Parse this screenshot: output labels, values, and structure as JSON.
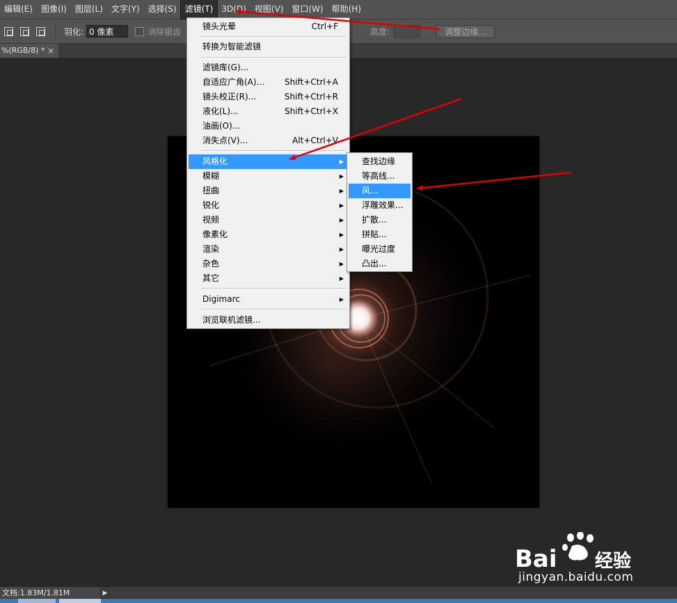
{
  "menubar": {
    "items": [
      {
        "label": "编辑(E)"
      },
      {
        "label": "图像(I)"
      },
      {
        "label": "图层(L)"
      },
      {
        "label": "文字(Y)"
      },
      {
        "label": "选择(S)"
      },
      {
        "label": "滤镜(T)"
      },
      {
        "label": "3D(D)"
      },
      {
        "label": "视图(V)"
      },
      {
        "label": "窗口(W)"
      },
      {
        "label": "帮助(H)"
      }
    ],
    "active_item": "滤镜(T)"
  },
  "options_bar": {
    "feather_label": "羽化:",
    "feather_value": "0 像素",
    "anti_alias_label": "消除锯齿",
    "height_label": "高度:",
    "refine_edge_button": "调整边缘..."
  },
  "document_tab": {
    "title": "%(RGB/8) *",
    "close_glyph": "×"
  },
  "filter_menu": {
    "last_filter": {
      "label": "镜头光晕",
      "shortcut": "Ctrl+F"
    },
    "convert_smart": "转换为智能滤镜",
    "items_group1": [
      {
        "label": "滤镜库(G)...",
        "shortcut": ""
      },
      {
        "label": "自适应广角(A)...",
        "shortcut": "Shift+Ctrl+A"
      },
      {
        "label": "镜头校正(R)...",
        "shortcut": "Shift+Ctrl+R"
      },
      {
        "label": "液化(L)...",
        "shortcut": "Shift+Ctrl+X"
      },
      {
        "label": "油画(O)...",
        "shortcut": ""
      },
      {
        "label": "消失点(V)...",
        "shortcut": "Alt+Ctrl+V"
      }
    ],
    "submenus": [
      {
        "label": "风格化"
      },
      {
        "label": "模糊"
      },
      {
        "label": "扭曲"
      },
      {
        "label": "锐化"
      },
      {
        "label": "视频"
      },
      {
        "label": "像素化"
      },
      {
        "label": "渲染"
      },
      {
        "label": "杂色"
      },
      {
        "label": "其它"
      }
    ],
    "highlighted": "风格化",
    "digimarc": "Digimarc",
    "browse_online": "浏览联机滤镜..."
  },
  "stylize_submenu": {
    "items": [
      {
        "label": "查找边缘"
      },
      {
        "label": "等高线..."
      },
      {
        "label": "风..."
      },
      {
        "label": "浮雕效果..."
      },
      {
        "label": "扩散..."
      },
      {
        "label": "拼贴..."
      },
      {
        "label": "曝光过度"
      },
      {
        "label": "凸出..."
      }
    ],
    "highlighted": "风..."
  },
  "status_bar": {
    "doc_info": "文档:1.83M/1.81M"
  },
  "watermark": {
    "brand_left": "Bai",
    "brand_right": "经验",
    "url": "jingyan.baidu.com"
  },
  "colors": {
    "menu_highlight": "#3399ff",
    "annotation_arrow": "#e00000",
    "app_background": "#282828"
  }
}
